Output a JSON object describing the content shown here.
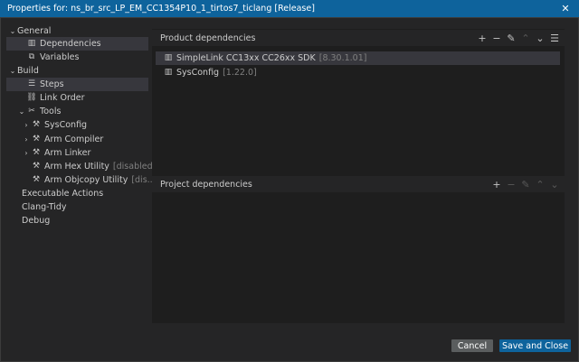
{
  "window": {
    "title": "Properties for: ns_br_src_LP_EM_CC1354P10_1_tirtos7_ticlang [Release]",
    "close_icon": "close-icon"
  },
  "sidebar": {
    "general": "General",
    "dependencies": "Dependencies",
    "variables": "Variables",
    "build": "Build",
    "steps": "Steps",
    "link_order": "Link Order",
    "tools": "Tools",
    "sysconfig": "SysConfig",
    "arm_compiler": "Arm Compiler",
    "arm_linker": "Arm Linker",
    "arm_hex_utility": "Arm Hex Utility",
    "arm_hex_utility_state": "[disabled]",
    "arm_objcopy_utility": "Arm Objcopy Utility",
    "arm_objcopy_utility_state": "[dis...",
    "executable_actions": "Executable Actions",
    "clang_tidy": "Clang-Tidy",
    "debug": "Debug"
  },
  "product_dependencies": {
    "header": "Product dependencies",
    "items": [
      {
        "name": "SimpleLink CC13xx CC26xx SDK",
        "version": "[8.30.1.01]"
      },
      {
        "name": "SysConfig",
        "version": "[1.22.0]"
      }
    ]
  },
  "project_dependencies": {
    "header": "Project dependencies"
  },
  "buttons": {
    "cancel": "Cancel",
    "save_and_close": "Save and Close"
  },
  "colors": {
    "titlebar": "#0e639c",
    "primary_button": "#0e639c",
    "selection": "#37373d",
    "panel": "#1e1e1e",
    "sidebar": "#252526"
  }
}
